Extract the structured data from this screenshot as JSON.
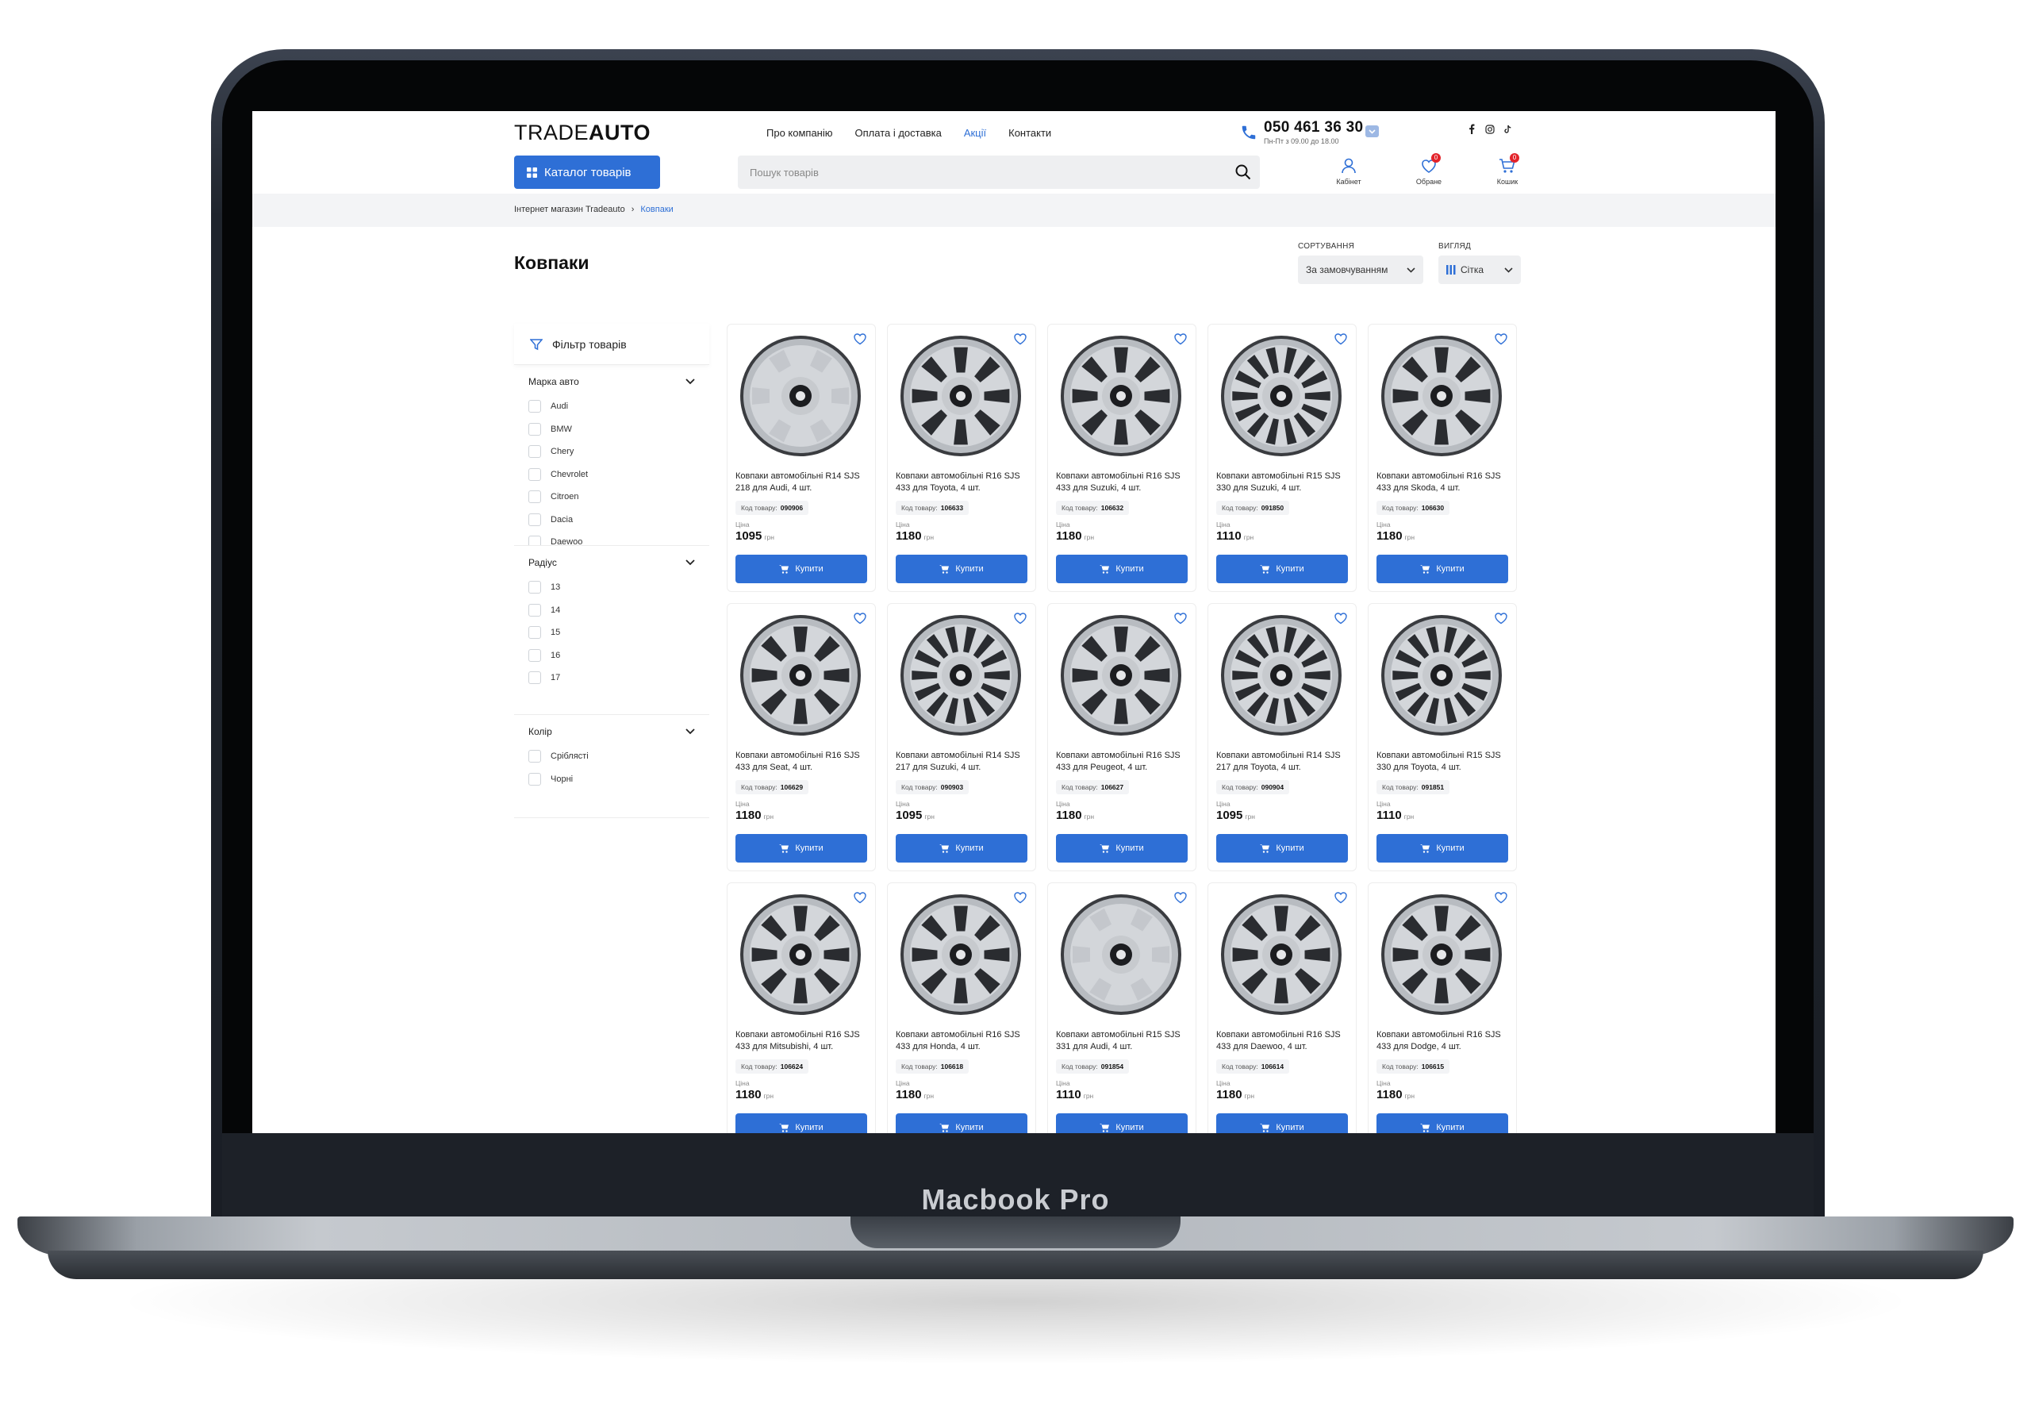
{
  "device": {
    "label": "Macbook Pro"
  },
  "header": {
    "logo_light": "TRADE",
    "logo_bold": "AUTO",
    "nav": [
      {
        "label": "Про компанію"
      },
      {
        "label": "Оплата і доставка"
      },
      {
        "label": "Акції"
      },
      {
        "label": "Контакти"
      }
    ],
    "phone": "050 461 36 30",
    "hours": "Пн-Пт з 09.00 до 18.00",
    "catalog_label": "Каталог товарів",
    "search_placeholder": "Пошук товарів",
    "cabinet_label": "Кабінет",
    "favorites_label": "Обране",
    "favorites_count": "0",
    "cart_label": "Кошик",
    "cart_count": "0"
  },
  "breadcrumb": {
    "home": "Інтернет магазин Tradeauto",
    "current": "Ковпаки"
  },
  "page": {
    "title": "Ковпаки",
    "sort_label": "СОРТУВАННЯ",
    "sort_value": "За замовчуванням",
    "view_label": "ВИГЛЯД",
    "view_value": "Сітка"
  },
  "filter": {
    "title": "Фільтр товарів",
    "groups": [
      {
        "title": "Марка авто",
        "options": [
          "Audi",
          "BMW",
          "Chery",
          "Chevrolet",
          "Citroen",
          "Dacia",
          "Daewoo"
        ]
      },
      {
        "title": "Радіус",
        "options": [
          "13",
          "14",
          "15",
          "16",
          "17"
        ]
      },
      {
        "title": "Колір",
        "options": [
          "Сріблясті",
          "Чорні"
        ]
      }
    ]
  },
  "products": {
    "code_label": "Код товару:",
    "price_label": "Ціна",
    "currency": "грн",
    "buy_label": "Купити",
    "items": [
      {
        "name": "Ковпаки автомобільні R14 SJS 218 для Audi, 4 шт.",
        "code": "090906",
        "price": "1095",
        "icon": "wheel-cover-audi-icon"
      },
      {
        "name": "Ковпаки автомобільні R16 SJS 433 для Toyota, 4 шт.",
        "code": "106633",
        "price": "1180",
        "icon": "wheel-cover-toyota-icon"
      },
      {
        "name": "Ковпаки автомобільні R16 SJS 433 для Suzuki, 4 шт.",
        "code": "106632",
        "price": "1180",
        "icon": "wheel-cover-suzuki-icon"
      },
      {
        "name": "Ковпаки автомобільні R15 SJS 330 для Suzuki, 4 шт.",
        "code": "091850",
        "price": "1110",
        "icon": "wheel-cover-suzuki-icon"
      },
      {
        "name": "Ковпаки автомобільні R16 SJS 433 для Skoda, 4 шт.",
        "code": "106630",
        "price": "1180",
        "icon": "wheel-cover-skoda-icon"
      },
      {
        "name": "Ковпаки автомобільні R16 SJS 433 для Seat, 4 шт.",
        "code": "106629",
        "price": "1180",
        "icon": "wheel-cover-seat-icon"
      },
      {
        "name": "Ковпаки автомобільні R14 SJS 217 для Suzuki, 4 шт.",
        "code": "090903",
        "price": "1095",
        "icon": "wheel-cover-suzuki-icon"
      },
      {
        "name": "Ковпаки автомобільні R16 SJS 433 для Peugeot, 4 шт.",
        "code": "106627",
        "price": "1180",
        "icon": "wheel-cover-peugeot-icon"
      },
      {
        "name": "Ковпаки автомобільні R14 SJS 217 для Toyota, 4 шт.",
        "code": "090904",
        "price": "1095",
        "icon": "wheel-cover-toyota-icon"
      },
      {
        "name": "Ковпаки автомобільні R15 SJS 330 для Toyota, 4 шт.",
        "code": "091851",
        "price": "1110",
        "icon": "wheel-cover-toyota-icon"
      },
      {
        "name": "Ковпаки автомобільні R16 SJS 433 для Mitsubishi, 4 шт.",
        "code": "106624",
        "price": "1180",
        "icon": "wheel-cover-mitsubishi-icon"
      },
      {
        "name": "Ковпаки автомобільні R16 SJS 433 для Honda, 4 шт.",
        "code": "106618",
        "price": "1180",
        "icon": "wheel-cover-honda-icon"
      },
      {
        "name": "Ковпаки автомобільні R15 SJS 331 для Audi, 4 шт.",
        "code": "091854",
        "price": "1110",
        "icon": "wheel-cover-audi-icon"
      },
      {
        "name": "Ковпаки автомобільні R16 SJS 433 для Daewoo, 4 шт.",
        "code": "106614",
        "price": "1180",
        "icon": "wheel-cover-daewoo-icon"
      },
      {
        "name": "Ковпаки автомобільні R16 SJS 433 для Dodge, 4 шт.",
        "code": "106615",
        "price": "1180",
        "icon": "wheel-cover-dodge-icon"
      }
    ]
  },
  "colors": {
    "accent": "#2e6fd6",
    "badge": "#e3242b",
    "muted_bg": "#f3f4f6"
  }
}
